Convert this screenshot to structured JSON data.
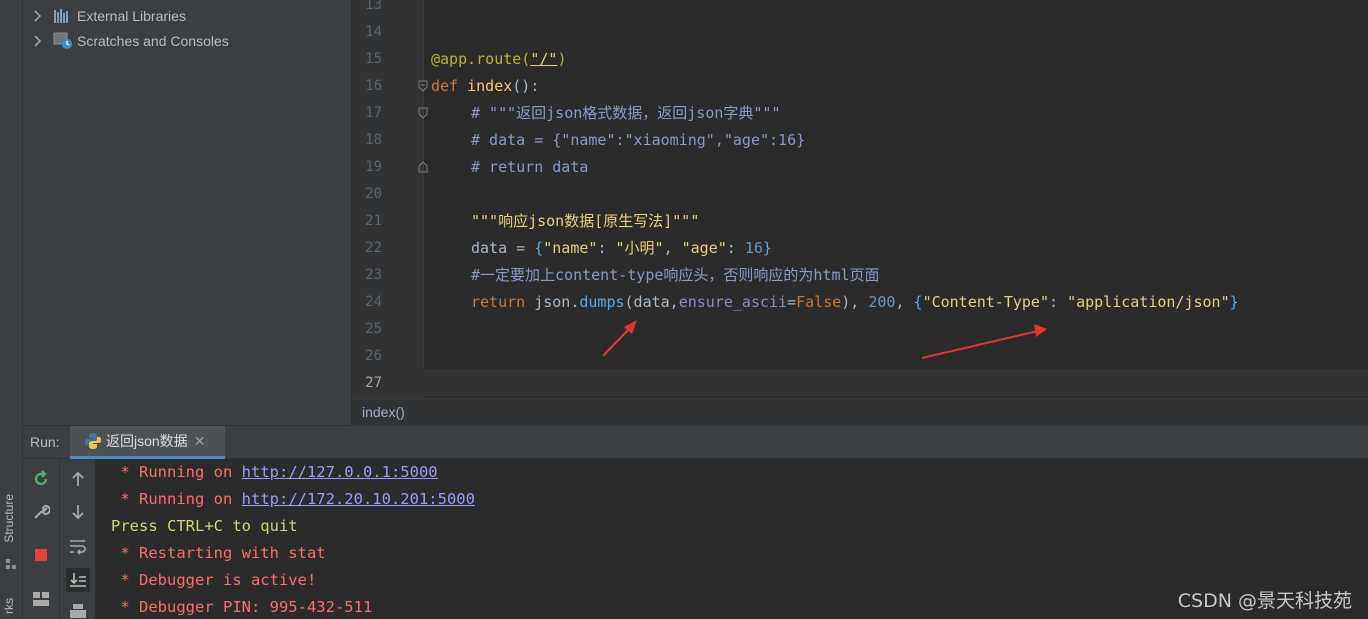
{
  "project_tree": {
    "items": [
      {
        "label": "External Libraries",
        "icon": "library-icon"
      },
      {
        "label": "Scratches and Consoles",
        "icon": "scratches-icon"
      }
    ]
  },
  "left_strip": {
    "structure_label": "Structure",
    "bookmarks_label": "rks"
  },
  "editor": {
    "line_numbers": [
      "13",
      "14",
      "15",
      "16",
      "17",
      "18",
      "19",
      "20",
      "21",
      "22",
      "23",
      "24",
      "25",
      "26",
      "27"
    ],
    "current_line": "27",
    "breadcrumb": "index()",
    "code": {
      "l15_deco": "@app.route(",
      "l15_str": "\"/\"",
      "l15_close": ")",
      "l16_kw": "def ",
      "l16_fn": "index",
      "l16_rest": "():",
      "l17": "# \"\"\"返回json格式数据，返回json字典\"\"\"",
      "l18": "# data = {\"name\":\"xiaoming\",\"age\":16}",
      "l19": "# return data",
      "l21": "\"\"\"响应json数据[原生写法]\"\"\"",
      "l22_a": "data = ",
      "l22_b": "{",
      "l22_c": "\"name\"",
      "l22_d": ": ",
      "l22_e": "\"小明\"",
      "l22_f": ", ",
      "l22_g": "\"age\"",
      "l22_h": ": ",
      "l22_i": "16",
      "l22_j": "}",
      "l23": "#一定要加上content-type响应头，否则响应的为html页面",
      "l24_kw": "return ",
      "l24_a": "json.",
      "l24_call": "dumps",
      "l24_b": "(data,",
      "l24_kwarg": "ensure_ascii",
      "l24_c": "=",
      "l24_false": "False",
      "l24_d": "), ",
      "l24_num": "200",
      "l24_e": ", ",
      "l24_f": "{",
      "l24_g": "\"Content-Type\"",
      "l24_h": ": ",
      "l24_i": "\"application/json\"",
      "l24_j": "}"
    }
  },
  "run": {
    "title": "Run:",
    "tab_label": "返回json数据",
    "tab_close": "✕",
    "console": [
      {
        "prefix": " * Running on ",
        "link": "http://127.0.0.1:5000",
        "type": "err"
      },
      {
        "prefix": " * Running on ",
        "link": "http://172.20.10.201:5000",
        "type": "err"
      },
      {
        "text": "Press CTRL+C to quit",
        "type": "plain"
      },
      {
        "text": " * Restarting with stat",
        "type": "err"
      },
      {
        "text": " * Debugger is active!",
        "type": "err"
      },
      {
        "text": " * Debugger PIN: 995-432-511",
        "type": "err"
      }
    ]
  },
  "watermark": "CSDN @景天科技苑",
  "colors": {
    "annotation_arrow": "#e8332a",
    "error_text": "#ff6b68",
    "plain_text": "#d3d96b"
  }
}
